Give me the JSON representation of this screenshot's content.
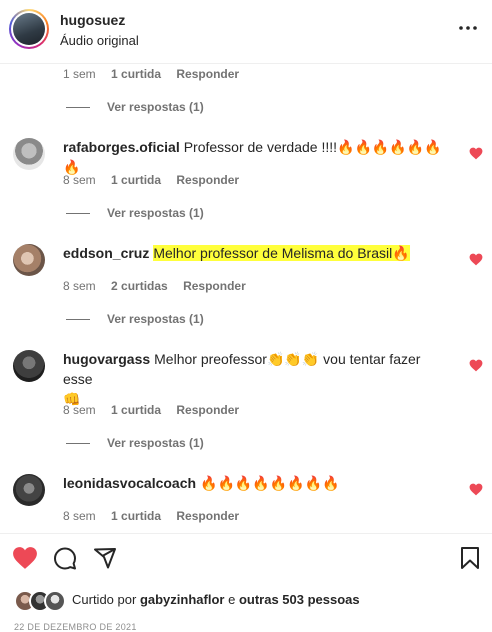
{
  "post": {
    "username": "hugosuez",
    "audio": "Áudio original"
  },
  "top_comment_tail": {
    "time": "1 sem",
    "likes": "1 curtida",
    "reply": "Responder",
    "view_replies": "Ver respostas (1)"
  },
  "comments": [
    {
      "user": "rafaborges.oficial",
      "text": "Professor de verdade !!!!",
      "emoji": "🔥🔥🔥🔥🔥🔥🔥",
      "time": "8 sem",
      "likes": "1 curtida",
      "reply": "Responder",
      "view_replies": "Ver respostas (1)"
    },
    {
      "user": "eddson_cruz",
      "text": "Melhor professor de Melisma do Brasil",
      "emoji": "🔥",
      "time": "8 sem",
      "likes": "2 curtidas",
      "reply": "Responder",
      "view_replies": "Ver respostas (1)"
    },
    {
      "user": "hugovargass",
      "text": "Melhor preofessor",
      "emoji": "👏👏👏",
      "text2": "vou tentar fazer esse",
      "emoji2": "👊",
      "time": "8 sem",
      "likes": "1 curtida",
      "reply": "Responder",
      "view_replies": "Ver respostas (1)"
    },
    {
      "user": "leonidasvocalcoach",
      "text": "",
      "emoji": "🔥🔥🔥🔥🔥🔥🔥🔥",
      "time": "8 sem",
      "likes": "1 curtida",
      "reply": "Responder"
    }
  ],
  "liked_by": {
    "prefix": "Curtido por",
    "user": "gabyzinhaflor",
    "connector": "e",
    "others": "outras 503 pessoas"
  },
  "date": "22 DE DEZEMBRO DE 2021",
  "icons": [
    "more-icon",
    "heart-icon",
    "comment-icon",
    "share-icon",
    "bookmark-icon"
  ],
  "colors": {
    "like_red": "#ed4956",
    "highlight": "#ffff3b",
    "muted": "#737373"
  }
}
